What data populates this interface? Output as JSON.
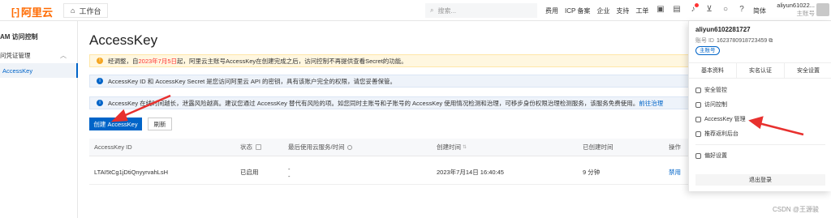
{
  "topbar": {
    "logo_text": "阿里云",
    "logo_mark": "[-]",
    "workbench_label": "工作台",
    "search_placeholder": "搜索...",
    "nav_links": [
      "费用",
      "ICP 备案",
      "企业",
      "支持",
      "工单"
    ],
    "lang": "简体",
    "user_name": "aliyun61022...",
    "user_sub": "主账号"
  },
  "sidebar": {
    "title": "AM 访问控制",
    "group_label": "问凭证管理",
    "active_item": "AccessKey"
  },
  "main": {
    "page_title": "AccessKey",
    "alert1_prefix": "经调整，自",
    "alert1_date": "2023年7月5日",
    "alert1_suffix": "起，阿里云主账号AccessKey在创建完成之后，访问控制不再提供查看Secret的功能。",
    "alert2": "AccessKey ID 和 AccessKey Secret 是您访问阿里云 API 的密钥，具有该账户完全的权限，请您妥善保管。",
    "alert3_text": "AccessKey 在线时间越长，泄露风险越高。建议您通过 AccessKey 替代有风险的项。如您同时主账号和子账号的 AccessKey 使用情况检测和治理，可移步身份权限治理检测服务，该服务免费使用。",
    "alert3_link": "前往治理",
    "create_button": "创建 AccessKey",
    "refresh_button": "刷新",
    "table": {
      "headers": [
        "AccessKey ID",
        "状态",
        "最后使用云服务/时间",
        "创建时间",
        "已创建时间",
        "操作"
      ],
      "row": {
        "id": "LTAI5tCg1jDtiQnyyrvahLsH",
        "status": "已启用",
        "last_used_1": "-",
        "last_used_2": "-",
        "created": "2023年7月14日 16:40:45",
        "age": "9 分钟",
        "action": "禁用"
      }
    }
  },
  "dropdown": {
    "name": "aliyun6102281727",
    "id_label": "账号 ID",
    "id_value": "1623780918723459",
    "badge": "主账号",
    "tabs": [
      "基本资料",
      "实名认证",
      "安全设置"
    ],
    "menu": [
      "安全管控",
      "访问控制",
      "AccessKey 管理",
      "推荐返利后台",
      "偏好设置"
    ],
    "logout": "退出登录"
  },
  "watermark": "CSDN @王源骏",
  "colors": {
    "accent": "#0064c8",
    "brand": "#ff6a00",
    "arrow": "#e8302e"
  }
}
